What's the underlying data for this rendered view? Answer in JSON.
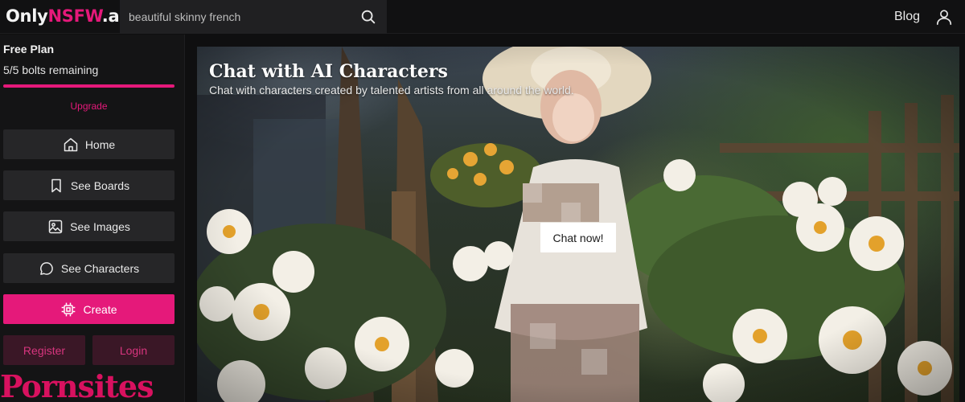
{
  "header": {
    "logo_part1": "Only",
    "logo_part2": "NSFW",
    "logo_part3": ".ai",
    "search_value": "beautiful skinny french",
    "blog_label": "Blog",
    "icons": {
      "search": "search-icon",
      "user": "user-icon"
    }
  },
  "sidebar": {
    "plan_title": "Free Plan",
    "plan_status": "5/5 bolts remaining",
    "bolts_progress": 1.0,
    "upgrade_label": "Upgrade",
    "nav": [
      {
        "label": "Home",
        "icon": "home-icon"
      },
      {
        "label": "See Boards",
        "icon": "bookmark-icon"
      },
      {
        "label": "See Images",
        "icon": "image-icon"
      },
      {
        "label": "See Characters",
        "icon": "chat-bubble-icon"
      }
    ],
    "create_label": "Create",
    "create_icon": "chip-icon",
    "register_label": "Register",
    "login_label": "Login",
    "banner_text": "Pornsites"
  },
  "hero": {
    "title": "Chat with AI Characters",
    "subtitle": "Chat with characters created by talented artists from all around the world.",
    "cta_label": "Chat now!"
  },
  "colors": {
    "accent": "#e5197a",
    "background": "#0f0f10",
    "sidebar_button": "#262628"
  }
}
